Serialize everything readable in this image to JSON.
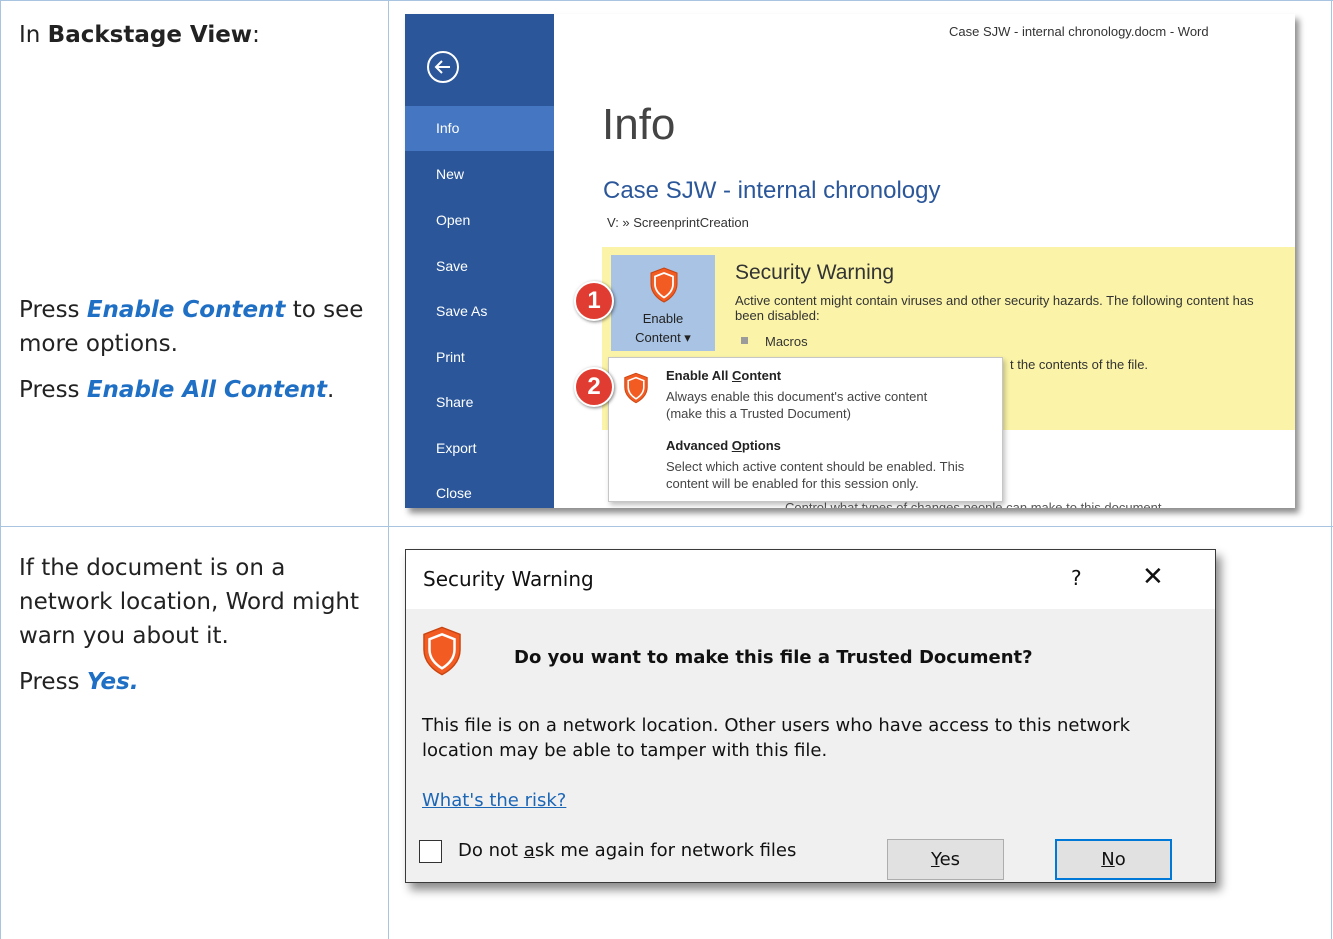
{
  "rows": [
    {
      "instructions": {
        "intro_prefix": "In ",
        "intro_bold": "Backstage View",
        "intro_suffix": ":",
        "step1_prefix": "Press ",
        "step1_highlight": "Enable Content",
        "step1_suffix": " to see more options.",
        "step2_prefix": "Press ",
        "step2_highlight": "Enable All Content",
        "step2_suffix": "."
      }
    },
    {
      "instructions": {
        "line1": "If the document is on a network location, Word might warn you about it.",
        "step_prefix": "Press ",
        "step_highlight": "Yes."
      }
    }
  ],
  "word_window": {
    "title": "Case SJW - internal chronology.docm - Word",
    "nav_items": [
      "Info",
      "New",
      "Open",
      "Save",
      "Save As",
      "Print",
      "Share",
      "Export",
      "Close"
    ],
    "active_nav": "Info",
    "page_title": "Info",
    "doc_title": "Case SJW - internal chronology",
    "doc_path": "V: » ScreenprintCreation",
    "security_warning": {
      "title": "Security Warning",
      "description": "Active content might contain viruses and other security hazards. The following content has been disabled:",
      "bullet": "Macros",
      "trailing_text": "t the contents of the file."
    },
    "enable_button": {
      "line1": "Enable",
      "line2": "Content ▾"
    },
    "dropdown": {
      "item1_title_pre": "Enable All ",
      "item1_title_ul": "C",
      "item1_title_post": "ontent",
      "item1_desc": "Always enable this document's active content (make this a Trusted Document)",
      "item2_title_pre": "Advanced ",
      "item2_title_ul": "O",
      "item2_title_post": "ptions",
      "item2_desc": "Select which active content should be enabled. This content will be enabled for this session only."
    },
    "partial_bottom_text": "Control what types of changes people can make to this document.",
    "badges": [
      "1",
      "2"
    ],
    "colors": {
      "sidebar": "#2b579a",
      "active_nav": "#4576c1",
      "warning_bg": "#fbf4a8",
      "shield": "#f25b22",
      "badge": "#e03c31"
    }
  },
  "dialog": {
    "title": "Security Warning",
    "help_glyph": "?",
    "close_glyph": "✕",
    "question": "Do you want to make this file a Trusted Document?",
    "body": "This file is on a network location. Other users who have access to this network location may be able to tamper with this file.",
    "risk_link": "What's the risk?",
    "checkbox_pre": "Do not ",
    "checkbox_ul": "a",
    "checkbox_post": "sk me again for network files",
    "yes_pre": "",
    "yes_ul": "Y",
    "yes_post": "es",
    "no_pre": "",
    "no_ul": "N",
    "no_post": "o"
  }
}
